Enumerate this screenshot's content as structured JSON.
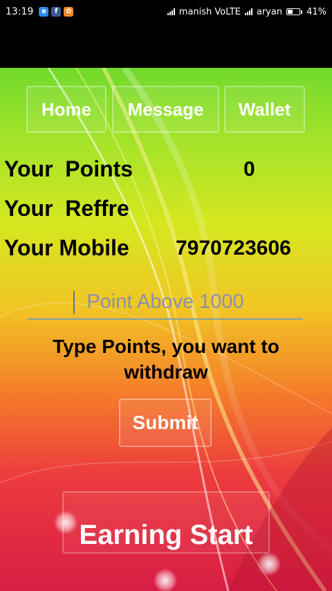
{
  "status_bar": {
    "time": "13:19",
    "carrier1": "manish VoLTE",
    "carrier2": "aryan",
    "battery": "41%",
    "battery_level": 0.41,
    "notification_icons": [
      "bluetooth-icon",
      "facebook-icon",
      "app-notification-icon"
    ]
  },
  "nav": {
    "home": "Home",
    "message": "Message",
    "wallet": "Wallet"
  },
  "info": {
    "points_label": "Your  Points",
    "points_value": "0",
    "referral_label": "Your  Reffre",
    "referral_value": "",
    "mobile_label": "Your Mobile",
    "mobile_value": "7970723606"
  },
  "withdraw": {
    "input_placeholder": "Point Above 1000",
    "input_value": "",
    "hint": "Type Points, you want to withdraw",
    "submit": "Submit"
  },
  "footer": {
    "earning_start": "Earning Start"
  }
}
